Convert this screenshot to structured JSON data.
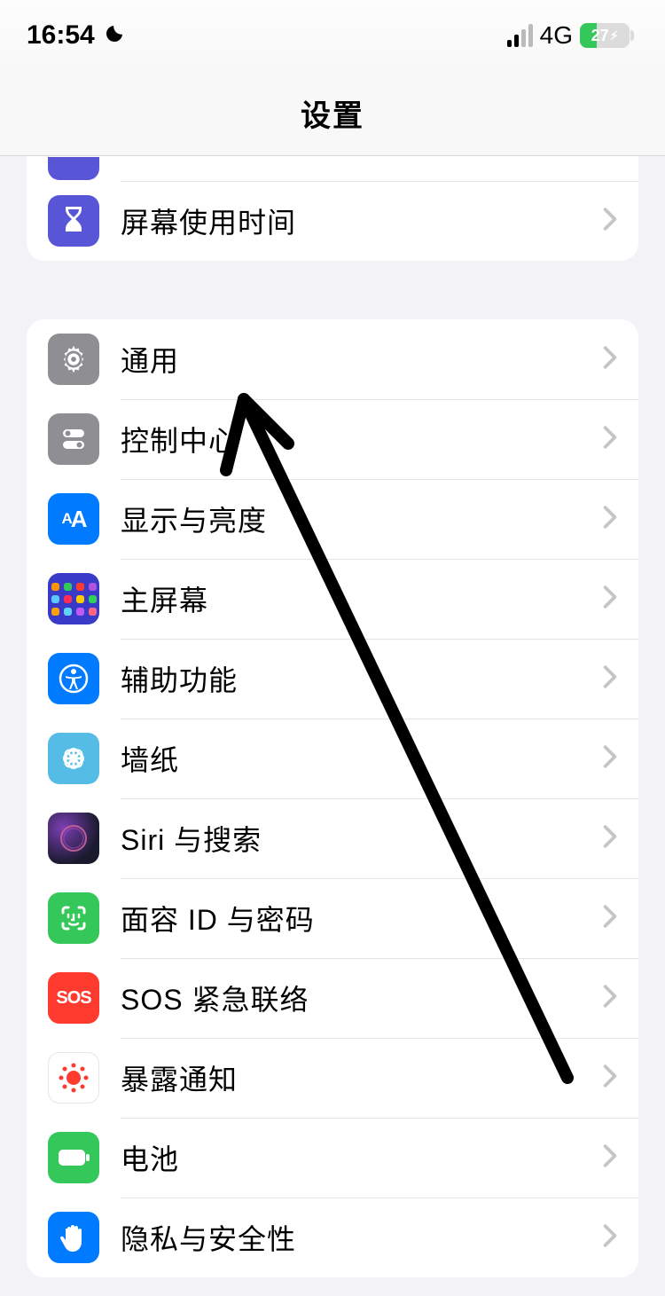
{
  "status": {
    "time": "16:54",
    "network": "4G",
    "battery_pct": "27"
  },
  "header": {
    "title": "设置"
  },
  "group1": {
    "items": [
      {
        "label": "屏幕使用时间"
      }
    ]
  },
  "group2": {
    "items": [
      {
        "label": "通用"
      },
      {
        "label": "控制中心"
      },
      {
        "label": "显示与亮度"
      },
      {
        "label": "主屏幕"
      },
      {
        "label": "辅助功能"
      },
      {
        "label": "墙纸"
      },
      {
        "label": "Siri 与搜索"
      },
      {
        "label": "面容 ID 与密码"
      },
      {
        "label": "SOS 紧急联络"
      },
      {
        "label": "暴露通知"
      },
      {
        "label": "电池"
      },
      {
        "label": "隐私与安全性"
      }
    ]
  },
  "icons": {
    "sos_text": "SOS",
    "display_text": "AA"
  }
}
